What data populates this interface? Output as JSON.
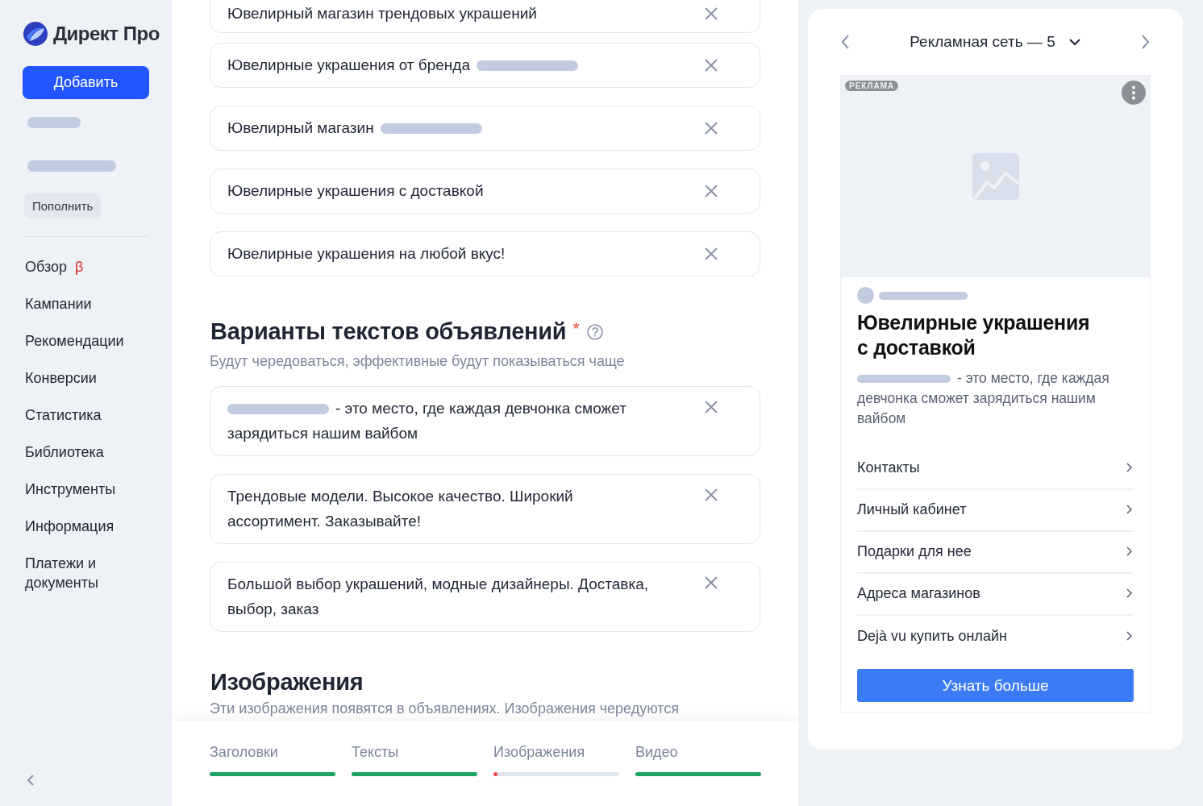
{
  "sidebar": {
    "logo": "Директ Про",
    "add_button": "Добавить",
    "top_up_button": "Пополнить",
    "nav": [
      {
        "label": "Обзор",
        "badge": "β"
      },
      {
        "label": "Кампании"
      },
      {
        "label": "Рекомендации"
      },
      {
        "label": "Конверсии"
      },
      {
        "label": "Статистика"
      },
      {
        "label": "Библиотека"
      },
      {
        "label": "Инструменты"
      },
      {
        "label": "Информация"
      },
      {
        "label": "Платежи и документы"
      }
    ]
  },
  "headlines": [
    {
      "text": "Ювелирный магазин трендовых украшений"
    },
    {
      "text": "Ювелирные украшения от бренда",
      "blur_after": true
    },
    {
      "text": "Ювелирный магазин",
      "blur_after": true
    },
    {
      "text": "Ювелирные украшения с доставкой"
    },
    {
      "text": "Ювелирные украшения на любой вкус!"
    }
  ],
  "texts_section": {
    "title": "Варианты текстов объявлений",
    "required_mark": "*",
    "subtitle": "Будут чередоваться, эффективные будут показываться чаще"
  },
  "texts": [
    {
      "text": "- это место, где каждая девчонка сможет зарядиться нашим вайбом",
      "blur_before": true
    },
    {
      "text": "Трендовые модели. Высокое качество. Широкий ассортимент. Заказывайте!"
    },
    {
      "text": "Большой выбор украшений, модные дизайнеры. Доставка, выбор, заказ"
    }
  ],
  "images_section": {
    "title": "Изображения",
    "subtitle": "Эти изображения появятся в объявлениях. Изображения чередуются"
  },
  "progress_tabs": [
    {
      "label": "Заголовки",
      "level": 1,
      "color": "#1ea362"
    },
    {
      "label": "Тексты",
      "level": 1,
      "color": "#1ea362"
    },
    {
      "label": "Изображения",
      "level": 0.03,
      "color": "#e84b4b"
    },
    {
      "label": "Видео",
      "level": 1,
      "color": "#1ea362"
    }
  ],
  "preview": {
    "network": "Рекламная сеть — 5",
    "ad_label": "РЕКЛАМА",
    "headline": "Ювелирные украшения с доставкой",
    "body_first_line": "- это место, где каждая",
    "body_rest": "девчонка сможет зарядиться нашим вайбом",
    "body_blur_before": true,
    "links": [
      "Контакты",
      "Личный кабинет",
      "Подарки для нее",
      "Адреса магазинов",
      "Dejà vu купить онлайн"
    ],
    "cta": "Узнать больше"
  }
}
